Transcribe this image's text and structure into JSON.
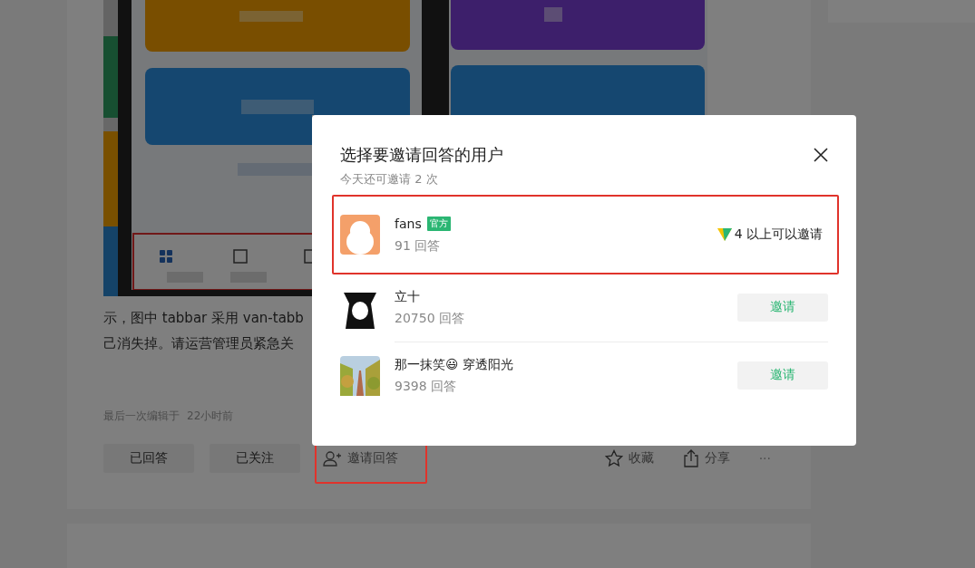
{
  "article": {
    "paragraph_lines": [
      "示，图中 tabbar 采用 van-tabb",
      "己消失掉。请运营管理员紧急关"
    ],
    "edit_time": {
      "label": "最后一次编辑于",
      "time": "22小时前"
    },
    "actions": [
      {
        "kind": "button",
        "label": "已回答"
      },
      {
        "kind": "button",
        "label": "已关注"
      },
      {
        "kind": "invite",
        "label": "邀请回答",
        "highlighted": true
      },
      {
        "kind": "favorite",
        "label": "收藏"
      },
      {
        "kind": "share",
        "label": "分享"
      },
      {
        "kind": "more",
        "label": "···"
      }
    ]
  },
  "dialog": {
    "title": "选择要邀请回答的用户",
    "subtitle": "今天还可邀请 2 次",
    "users": [
      {
        "name": "fans",
        "badge": "官方",
        "answers": "91 回答",
        "highlighted": true,
        "action": {
          "kind": "requirement",
          "label": "4 以上可以邀请"
        }
      },
      {
        "name": "立十",
        "answers": "20750 回答",
        "highlighted": false,
        "action": {
          "kind": "button",
          "label": "邀请"
        }
      },
      {
        "name": "那一抹笑😃 穿透阳光",
        "answers": "9398 回答",
        "highlighted": false,
        "action": {
          "kind": "button",
          "label": "邀请"
        }
      }
    ]
  }
}
